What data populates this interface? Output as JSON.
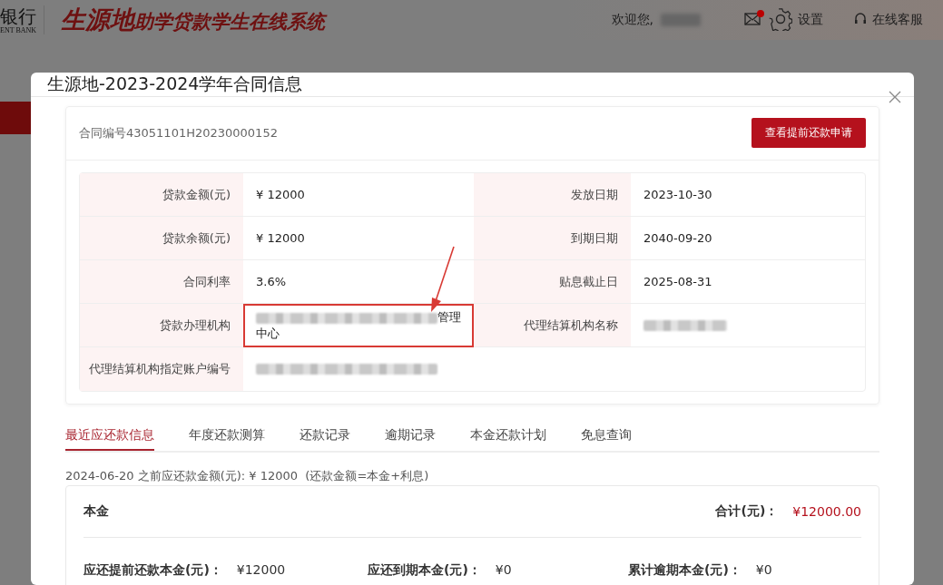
{
  "header": {
    "bank_logo": {
      "chinese": "银行",
      "english": "ENT BANK"
    },
    "system_title": {
      "main": "生源地",
      "rest": "助学贷款学生在线系统"
    },
    "welcome": "欢迎您,",
    "user_name_redacted": true,
    "mail": {
      "unread": true
    },
    "settings": "设置",
    "support": "在线客服"
  },
  "modal": {
    "title": "生源地-2023-2024学年合同信息",
    "contract_number": "合同编号43051101H20230000152",
    "action_button": "查看提前还款申请",
    "details": [
      {
        "label": "贷款金额(元)",
        "value": "¥ 12000",
        "label2": "发放日期",
        "value2": "2023-10-30"
      },
      {
        "label": "贷款余额(元)",
        "value": "¥ 12000",
        "label2": "到期日期",
        "value2": "2040-09-20"
      },
      {
        "label": "合同利率",
        "value": "3.6%",
        "label2": "贴息截止日",
        "value2": "2025-08-31"
      },
      {
        "label": "贷款办理机构",
        "value": "管理中心",
        "value_redacted": true,
        "highlighted": true,
        "label2": "代理结算机构名称",
        "value2_redacted": true
      },
      {
        "label": "代理结算机构指定账户编号",
        "value_redacted": true
      }
    ],
    "tabs": [
      {
        "label": "最近应还款信息",
        "selected": true
      },
      {
        "label": "年度还款测算",
        "selected": false
      },
      {
        "label": "还款记录",
        "selected": false
      },
      {
        "label": "逾期记录",
        "selected": false
      },
      {
        "label": "本金还款计划",
        "selected": false
      },
      {
        "label": "免息查询",
        "selected": false
      }
    ],
    "summary": "2024-06-20 之前应还款金额(元): ¥ 12000  (还款金额=本金+利息)",
    "principal": {
      "title": "本金",
      "total_label": "合计(元)：",
      "total_value": "¥12000.00",
      "items": [
        {
          "label": "应还提前还款本金(元)：",
          "value": "¥12000"
        },
        {
          "label": "应还到期本金(元)：",
          "value": "¥0"
        },
        {
          "label": "累计逾期本金(元)：",
          "value": "¥0"
        }
      ]
    }
  }
}
